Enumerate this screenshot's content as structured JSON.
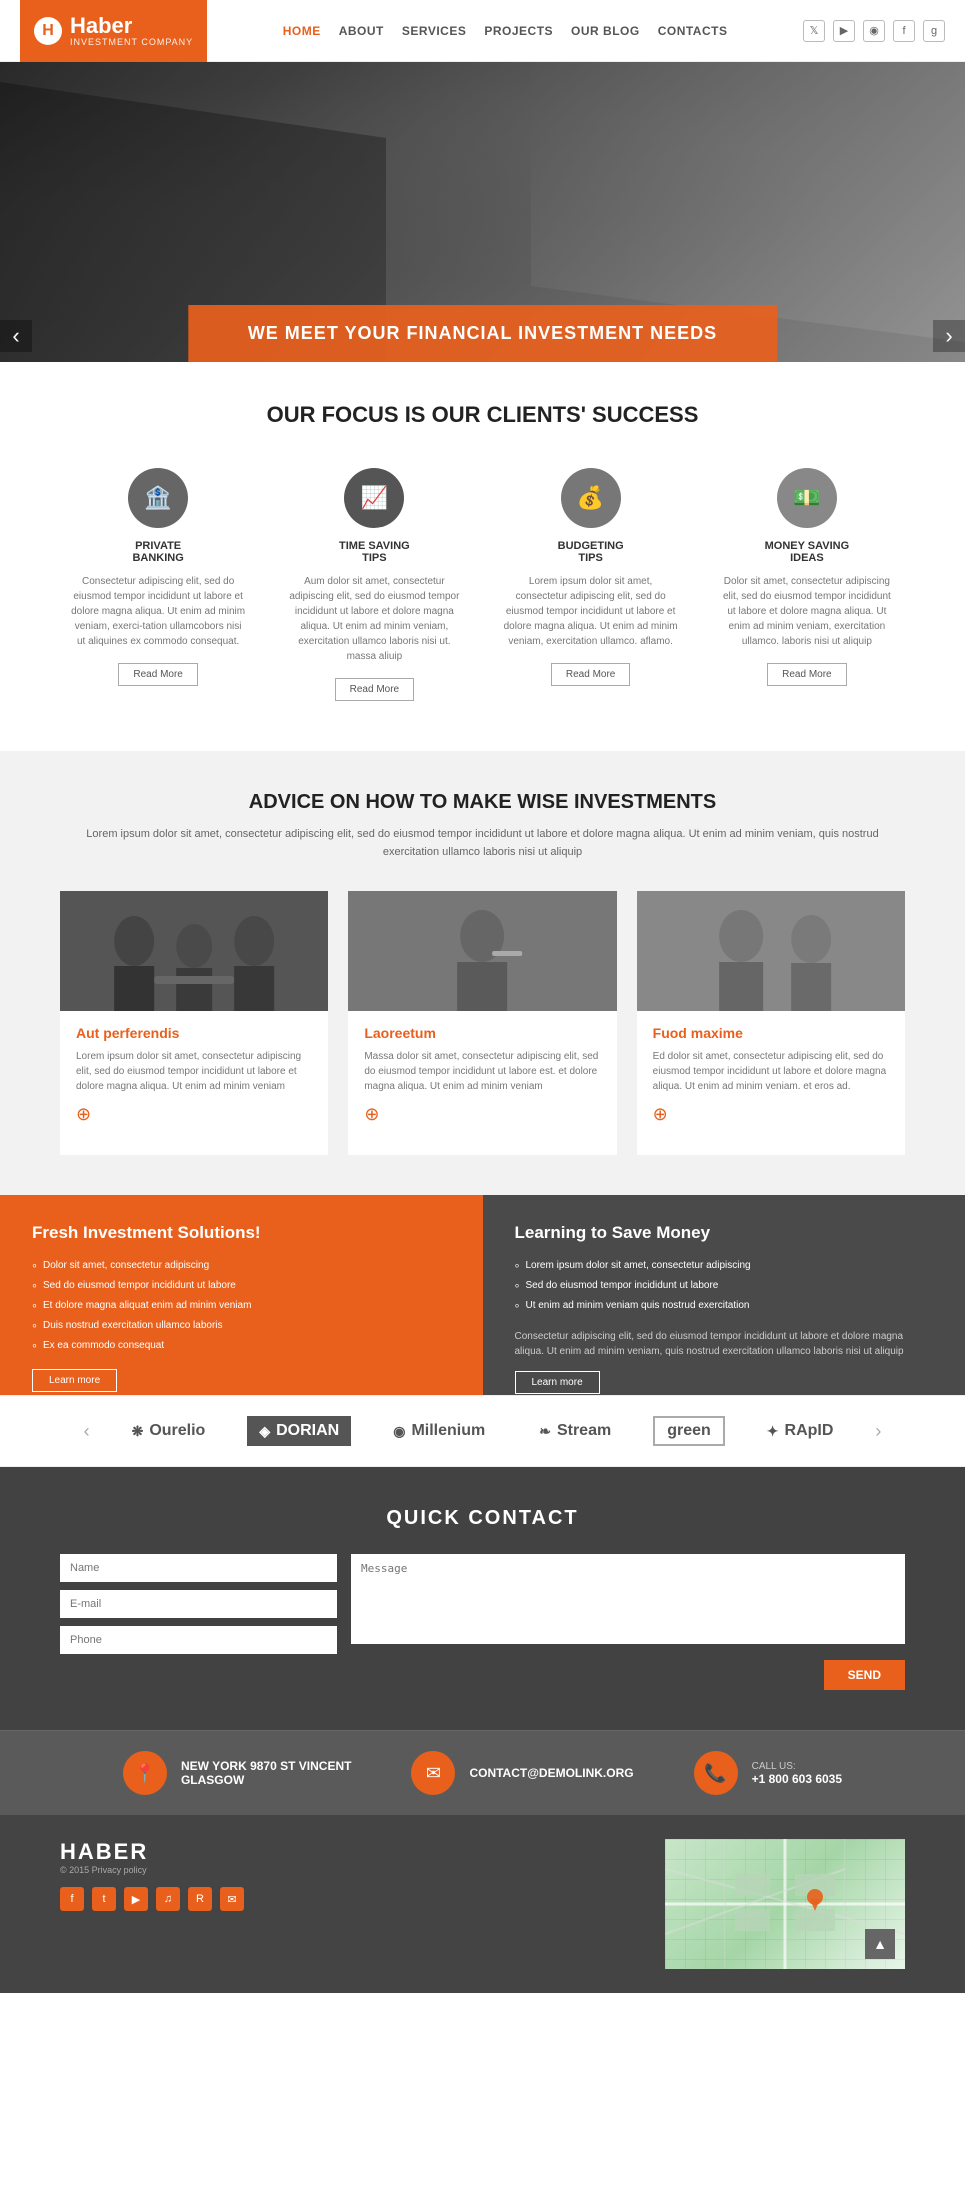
{
  "header": {
    "logo_name": "Haber",
    "logo_sub": "INVESTMENT COMPANY",
    "nav_items": [
      {
        "label": "HOME",
        "active": true
      },
      {
        "label": "ABOUT",
        "active": false
      },
      {
        "label": "SERVICES",
        "active": false
      },
      {
        "label": "PROJECTS",
        "active": false
      },
      {
        "label": "OUR BLOG",
        "active": false
      },
      {
        "label": "CONTACTS",
        "active": false
      }
    ]
  },
  "hero": {
    "banner_text": "WE MEET YOUR FINANCIAL INVESTMENT NEEDS"
  },
  "focus": {
    "title": "OUR FOCUS IS OUR CLIENTS' SUCCESS",
    "cards": [
      {
        "title": "PRIVATE\nBANKING",
        "text": "Consectetur adipiscing elit, sed do eiusmod tempor incididunt ut labore et dolore magna aliqua. Ut enim ad minim veniam, exerci-tation ullamcobors nisi ut aliquines ex commodo consequat.",
        "btn": "Read More"
      },
      {
        "title": "TIME SAVING\nTIPS",
        "text": "Aum dolor sit amet, consectetur adipiscing elit, sed do eiusmod tempor incididunt ut labore et dolore magna aliqua. Ut enim ad minim veniam, exercitation ullamco laboris nisi ut. massa aliuip",
        "btn": "Read More"
      },
      {
        "title": "BUDGETING\nTIPS",
        "text": "Lorem ipsum dolor sit amet, consectetur adipiscing elit, sed do eiusmod tempor incididunt ut labore et dolore magna aliqua. Ut enim ad minim veniam, exercitation ullamco. aflamo.",
        "btn": "Read More"
      },
      {
        "title": "MONEY SAVING\nIDEAS",
        "text": "Dolor sit amet, consectetur adipiscing elit, sed do eiusmod tempor incididunt ut labore et dolore magna aliqua. Ut enim ad minim veniam, exercitation ullamco. laboris nisi ut aliquip",
        "btn": "Read More"
      }
    ]
  },
  "advice": {
    "title": "ADVICE ON HOW TO MAKE WISE INVESTMENTS",
    "subtitle": "Lorem ipsum dolor sit amet, consectetur adipiscing elit, sed do eiusmod tempor incididunt ut labore et dolore magna aliqua. Ut enim ad minim veniam, quis nostrud exercitation ullamco laboris nisi ut aliquip",
    "cards": [
      {
        "name": "Aut perferendis",
        "text": "Lorem ipsum dolor sit amet, consectetur adipiscing elit, sed do eiusmod tempor incididunt ut labore et dolore magna aliqua. Ut enim ad minim veniam"
      },
      {
        "name": "Laoreetum",
        "text": "Massa dolor sit amet, consectetur adipiscing elit, sed do eiusmod tempor incididunt ut labore est. et dolore magna aliqua. Ut enim ad minim veniam"
      },
      {
        "name": "Fuod maxime",
        "text": "Ed dolor sit amet, consectetur adipiscing elit, sed do eiusmod tempor incididunt ut labore et dolore magna aliqua. Ut enim ad minim veniam. et eros ad."
      }
    ]
  },
  "solutions": {
    "left_title": "Fresh Investment Solutions!",
    "left_items": [
      "Dolor sit amet, consectetur adipiscing",
      "Sed do eiusmod tempor incididunt ut labore",
      "Et dolore magna aliquat enim ad minim veniam",
      "Duis nostrud exercitation ullamco laboris",
      "Ex ea commodo consequat"
    ],
    "left_btn": "Learn more",
    "right_title": "Learning to Save Money",
    "right_items": [
      "Lorem ipsum dolor sit amet, consectetur adipiscing",
      "Sed do eiusmod tempor incididunt ut labore",
      "Ut enim ad minim veniam quis nostrud exercitation"
    ],
    "right_text": "Consectetur adipiscing elit, sed do eiusmod tempor incididunt ut labore et dolore magna aliqua. Ut enim ad minim veniam, quis nostrud exercitation ullamco laboris nisi ut aliquip",
    "right_btn": "Learn more"
  },
  "logos": {
    "items": [
      {
        "name": "Ourelio",
        "icon": "❋"
      },
      {
        "name": "DORIAN",
        "icon": "◈",
        "highlighted": true
      },
      {
        "name": "Millenium",
        "icon": "◉"
      },
      {
        "name": "Stream",
        "icon": "❧"
      },
      {
        "name": "green",
        "icon": "",
        "boxed": true
      },
      {
        "name": "RApID",
        "icon": "✦"
      }
    ]
  },
  "quick_contact": {
    "title": "QUICK CONTACT",
    "name_placeholder": "Name",
    "email_placeholder": "E-mail",
    "phone_placeholder": "Phone",
    "message_placeholder": "Message",
    "send_btn": "SEND"
  },
  "contact_info": {
    "items": [
      {
        "icon": "📍",
        "label": "NEW YORK 9870 ST VINCENT\nGLASGOW",
        "value": ""
      },
      {
        "icon": "✉",
        "label": "",
        "value": "CONTACT@DEMOLINK.ORG"
      },
      {
        "icon": "📞",
        "label": "CALL US:",
        "value": "+1 800 603 6035"
      }
    ]
  },
  "footer": {
    "logo_name": "HABER",
    "copyright": "© 2015  Privacy policy",
    "social_icons": [
      "f",
      "t",
      "▶",
      "♫",
      "R",
      "✉"
    ]
  }
}
